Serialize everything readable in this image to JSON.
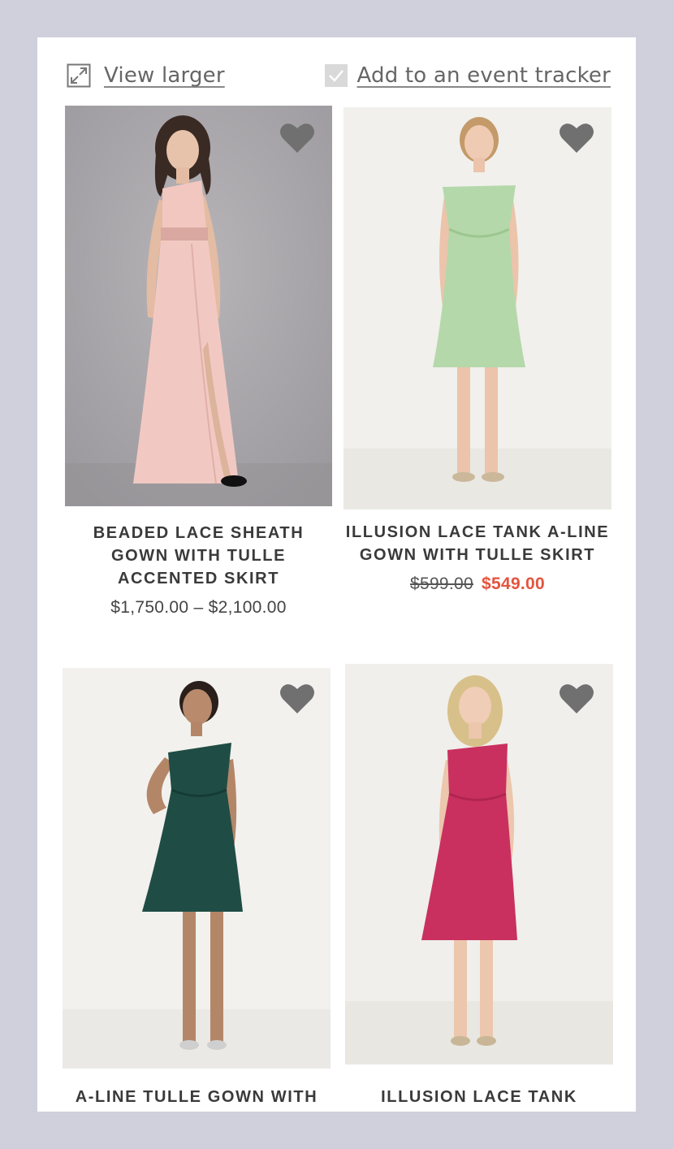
{
  "toolbar": {
    "view_larger": "View larger",
    "event_tracker": "Add to an event tracker",
    "icons": [
      "expand-icon",
      "checkmark-icon"
    ]
  },
  "products": [
    {
      "name_lines": [
        "BEADED LACE SHEATH",
        "GOWN WITH TULLE",
        "ACCENTED SKIRT"
      ],
      "price": "$1,750.00 – $2,100.00",
      "dress_color": "#f2c9c2",
      "background": "#aaa7ab"
    },
    {
      "name_lines": [
        "ILLUSION LACE TANK A-LINE",
        "GOWN WITH TULLE SKIRT"
      ],
      "old_price": "$599.00",
      "sale_price": "$549.00",
      "dress_color": "#b4d8aa",
      "background": "#f1f0ec"
    },
    {
      "name_lines": [
        "A-LINE TULLE GOWN WITH"
      ],
      "dress_color": "#1f4d45",
      "background": "#f2f1ee"
    },
    {
      "name_lines": [
        "ILLUSION LACE TANK"
      ],
      "dress_color": "#c9305f",
      "background": "#f0efeb"
    }
  ],
  "colors": {
    "page_bg": "#cfd0dc",
    "sale": "#e5533d",
    "heart": "#707070"
  }
}
